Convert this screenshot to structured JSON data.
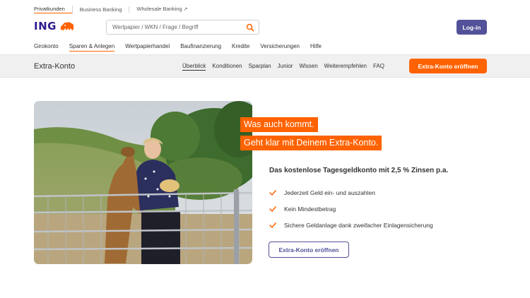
{
  "segments": [
    {
      "label": "Privatkunden",
      "active": true
    },
    {
      "label": "Business Banking",
      "active": false
    },
    {
      "label": "Wholesale Banking",
      "active": false,
      "external": true
    }
  ],
  "header": {
    "logo_text": "ING",
    "search_placeholder": "Wertpapier / WKN / Frage / Begriff",
    "login_label": "Log-in"
  },
  "main_nav": [
    {
      "label": "Girokonto"
    },
    {
      "label": "Sparen & Anlegen",
      "active": true
    },
    {
      "label": "Wertpapierhandel"
    },
    {
      "label": "Baufinanzierung"
    },
    {
      "label": "Kredite"
    },
    {
      "label": "Versicherungen"
    },
    {
      "label": "Hilfe"
    }
  ],
  "sub_nav": {
    "title": "Extra-Konto",
    "items": [
      {
        "label": "Überblick",
        "active": true
      },
      {
        "label": "Konditionen"
      },
      {
        "label": "Sparplan"
      },
      {
        "label": "Junior"
      },
      {
        "label": "Wissen"
      },
      {
        "label": "Weiterempfehlen"
      },
      {
        "label": "FAQ"
      }
    ],
    "cta_label": "Extra-Konto eröffnen"
  },
  "hero": {
    "headline_line1": "Was auch kommt.",
    "headline_line2": "Geht klar mit Deinem Extra-Konto.",
    "subheadline": "Das kostenlose Tagesgeldkonto mit 2,5 % Zinsen p.a.",
    "features": [
      "Jederzeit Geld ein- und auszahlen",
      "Kein Mindestbetrag",
      "Sichere Geldanlage dank zweifacher Einlagensicherung"
    ],
    "cta_label": "Extra-Konto eröffnen"
  },
  "colors": {
    "brand_orange": "#ff6200",
    "brand_purple": "#525199",
    "logo_blue": "#2c1c8c"
  }
}
